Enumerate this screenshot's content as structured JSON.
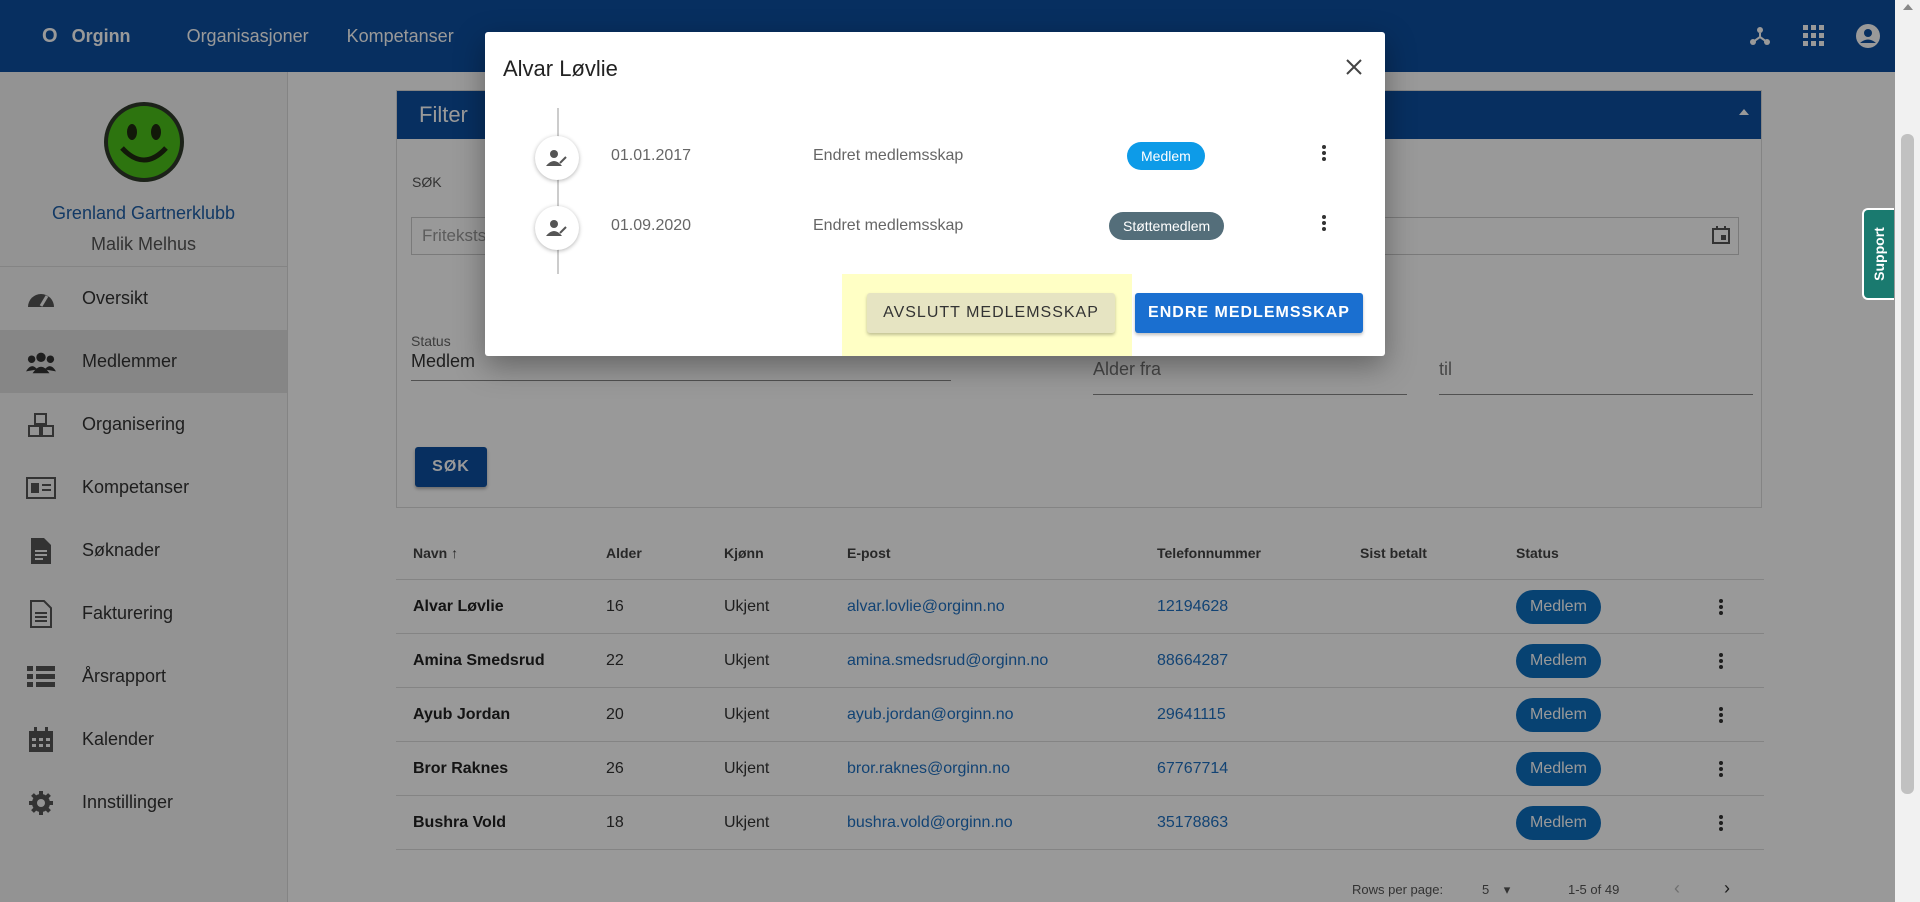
{
  "topbar": {
    "brand_mark": "O",
    "brand": "Orginn",
    "nav": [
      "Organisasjoner",
      "Kompetanser"
    ],
    "icons": [
      "network-icon",
      "apps-grid-icon",
      "account-circle-icon"
    ]
  },
  "sidebar": {
    "club_name": "Grenland Gartnerklubb",
    "user_name": "Malik Melhus",
    "items": [
      {
        "label": "Oversikt",
        "icon": "speedometer-icon"
      },
      {
        "label": "Medlemmer",
        "icon": "people-icon"
      },
      {
        "label": "Organisering",
        "icon": "cubes-icon"
      },
      {
        "label": "Kompetanser",
        "icon": "id-card-icon"
      },
      {
        "label": "Søknader",
        "icon": "document-icon"
      },
      {
        "label": "Fakturering",
        "icon": "invoice-icon"
      },
      {
        "label": "Årsrapport",
        "icon": "list-icon"
      },
      {
        "label": "Kalender",
        "icon": "calendar-icon"
      },
      {
        "label": "Innstillinger",
        "icon": "gear-icon"
      }
    ]
  },
  "filter": {
    "title": "Filter",
    "search_label": "SØK",
    "search_placeholder": "Fritekstsøk",
    "status_label": "Status",
    "status_value": "Medlem",
    "age_from": "Alder fra",
    "age_to": "til",
    "search_button": "SØK"
  },
  "table": {
    "headers": [
      "Navn",
      "Alder",
      "Kjønn",
      "E-post",
      "Telefonnummer",
      "Sist betalt",
      "Status"
    ],
    "rows": [
      {
        "name": "Alvar Løvlie",
        "age": "16",
        "gender": "Ukjent",
        "email": "alvar.lovlie@orginn.no",
        "phone": "12194628",
        "paid": "",
        "status": "Medlem"
      },
      {
        "name": "Amina Smedsrud",
        "age": "22",
        "gender": "Ukjent",
        "email": "amina.smedsrud@orginn.no",
        "phone": "88664287",
        "paid": "",
        "status": "Medlem"
      },
      {
        "name": "Ayub Jordan",
        "age": "20",
        "gender": "Ukjent",
        "email": "ayub.jordan@orginn.no",
        "phone": "29641115",
        "paid": "",
        "status": "Medlem"
      },
      {
        "name": "Bror Raknes",
        "age": "26",
        "gender": "Ukjent",
        "email": "bror.raknes@orginn.no",
        "phone": "67767714",
        "paid": "",
        "status": "Medlem"
      },
      {
        "name": "Bushra Vold",
        "age": "18",
        "gender": "Ukjent",
        "email": "bushra.vold@orginn.no",
        "phone": "35178863",
        "paid": "",
        "status": "Medlem"
      }
    ],
    "rows_per_page_label": "Rows per page:",
    "rows_per_page_value": "5",
    "range": "1-5 of 49"
  },
  "dialog": {
    "title": "Alvar Løvlie",
    "entries": [
      {
        "date": "01.01.2017",
        "description": "Endret medlemsskap",
        "badge": "Medlem",
        "badge_color": "#0d9be8"
      },
      {
        "date": "01.09.2020",
        "description": "Endret medlemsskap",
        "badge": "Støttemedlem",
        "badge_color": "#546e7a"
      }
    ],
    "end_button": "AVSLUTT MEDLEMSSKAP",
    "change_button": "ENDRE MEDLEMSSKAP"
  },
  "support_label": "Support",
  "colors": {
    "primary": "#0d4fa0",
    "accent": "#1a6fd0",
    "support": "#1a7a6f"
  }
}
